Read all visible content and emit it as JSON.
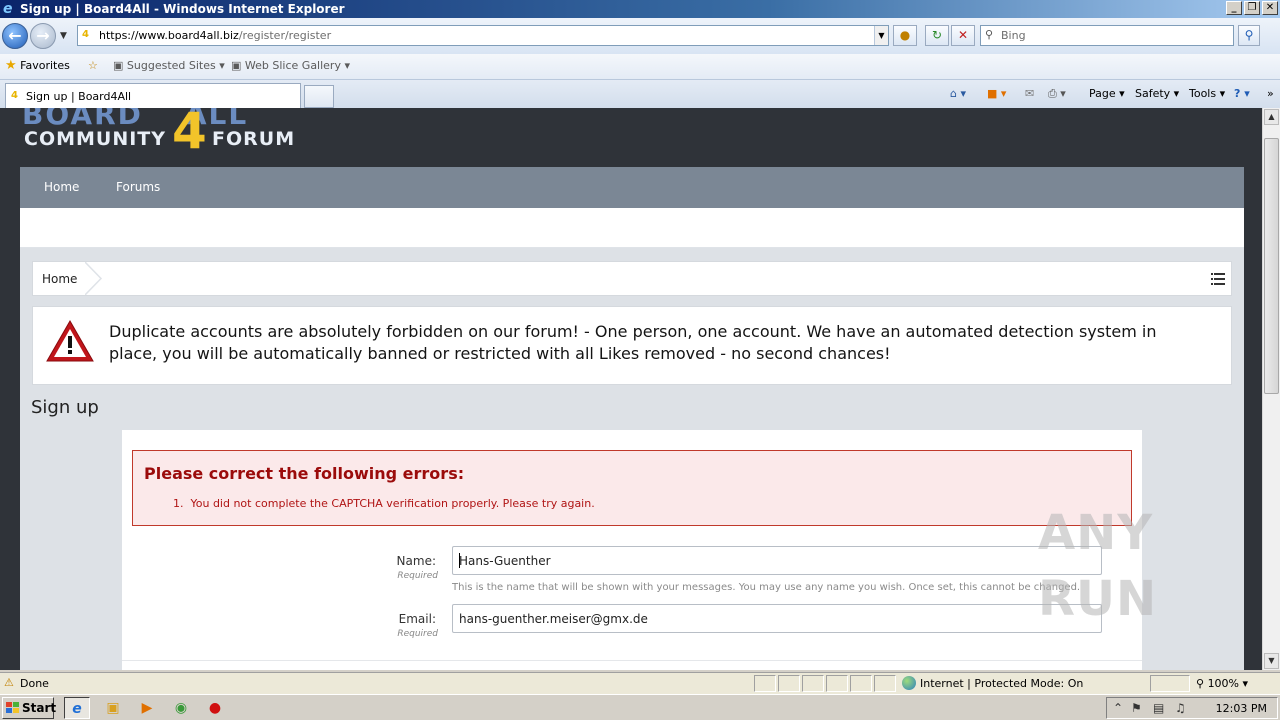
{
  "window": {
    "title": "Sign up | Board4All - Windows Internet Explorer",
    "buttons": [
      "_",
      "❐",
      "✕"
    ]
  },
  "addressbar": {
    "url_host": "https://www.board4all.biz",
    "url_path": "/register/register",
    "search_placeholder": "Bing"
  },
  "favorites": {
    "favorites_label": "Favorites",
    "suggested_sites": "Suggested Sites",
    "web_slice_gallery": "Web Slice Gallery"
  },
  "tabs": {
    "active_tab": "Sign up | Board4All"
  },
  "commandbar": {
    "page": "Page",
    "safety": "Safety",
    "tools": "Tools"
  },
  "site": {
    "logo_top": "BOARD",
    "logo_digit": "4",
    "logo_top_right": "ALL",
    "logo_bottom": "COMMUNITY",
    "logo_bottom_right": "FORUM",
    "nav": [
      "Home",
      "Forums"
    ],
    "breadcrumb_home": "Home",
    "notice": "Duplicate accounts are absolutely forbidden on our forum! - One person, one account. We have an automated detection system in place, you will be automatically banned or restricted with all Likes removed - no second chances!",
    "page_title": "Sign up"
  },
  "errors": {
    "heading": "Please correct the following errors:",
    "items": [
      "1.  You did not complete the CAPTCHA verification properly. Please try again."
    ]
  },
  "form": {
    "name_label": "Name:",
    "name_required": "Required",
    "name_value": "Hans-Guenther",
    "name_hint": "This is the name that will be shown with your messages. You may use any name you wish. Once set, this cannot be changed.",
    "email_label": "Email:",
    "email_required": "Required",
    "email_value": "hans-guenther.meiser@gmx.de"
  },
  "watermark": "ANY RUN",
  "statusbar": {
    "status": "Done",
    "zone": "Internet | Protected Mode: On",
    "zoom": "100%"
  },
  "taskbar": {
    "start": "Start",
    "clock": "12:03 PM"
  },
  "colors": {
    "navbar": "#7b8795",
    "page_bg": "#dde1e6",
    "header_bg": "#2f3339",
    "error_text": "#9b0b0b",
    "logo_yellow": "#f2c42a"
  }
}
